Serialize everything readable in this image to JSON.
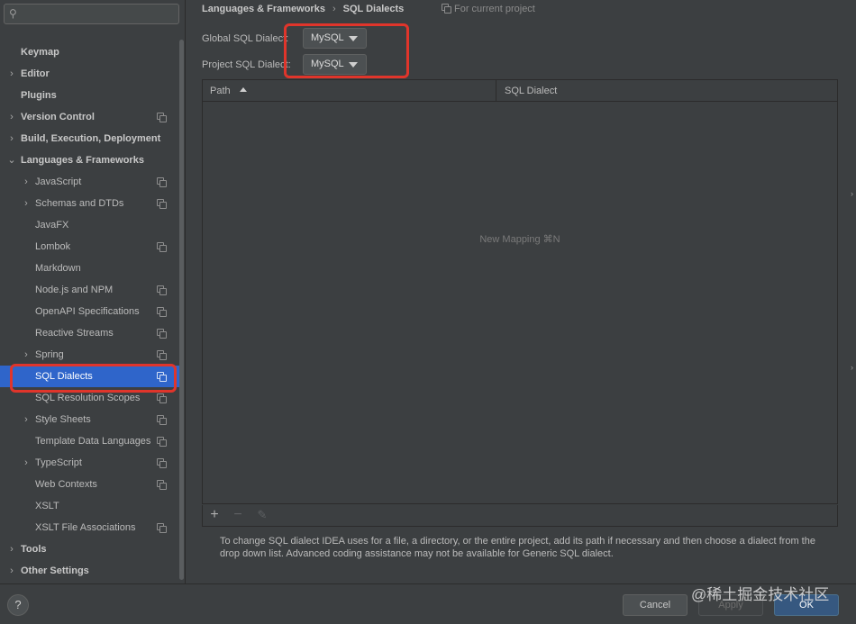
{
  "sidebar": {
    "search_placeholder": "",
    "items": [
      {
        "label": "Keymap",
        "level": 0,
        "bold": true,
        "arrow": "",
        "copy": false
      },
      {
        "label": "Editor",
        "level": 0,
        "bold": true,
        "arrow": "›",
        "copy": false
      },
      {
        "label": "Plugins",
        "level": 0,
        "bold": true,
        "arrow": "",
        "copy": false
      },
      {
        "label": "Version Control",
        "level": 0,
        "bold": true,
        "arrow": "›",
        "copy": true
      },
      {
        "label": "Build, Execution, Deployment",
        "level": 0,
        "bold": true,
        "arrow": "›",
        "copy": false
      },
      {
        "label": "Languages & Frameworks",
        "level": 0,
        "bold": true,
        "arrow": "⌄",
        "copy": false
      },
      {
        "label": "JavaScript",
        "level": 1,
        "bold": false,
        "arrow": "›",
        "copy": true
      },
      {
        "label": "Schemas and DTDs",
        "level": 1,
        "bold": false,
        "arrow": "›",
        "copy": true
      },
      {
        "label": "JavaFX",
        "level": 1,
        "bold": false,
        "arrow": "",
        "copy": false
      },
      {
        "label": "Lombok",
        "level": 1,
        "bold": false,
        "arrow": "",
        "copy": true
      },
      {
        "label": "Markdown",
        "level": 1,
        "bold": false,
        "arrow": "",
        "copy": false
      },
      {
        "label": "Node.js and NPM",
        "level": 1,
        "bold": false,
        "arrow": "",
        "copy": true
      },
      {
        "label": "OpenAPI Specifications",
        "level": 1,
        "bold": false,
        "arrow": "",
        "copy": true
      },
      {
        "label": "Reactive Streams",
        "level": 1,
        "bold": false,
        "arrow": "",
        "copy": true
      },
      {
        "label": "Spring",
        "level": 1,
        "bold": false,
        "arrow": "›",
        "copy": true
      },
      {
        "label": "SQL Dialects",
        "level": 1,
        "bold": false,
        "arrow": "",
        "copy": true,
        "selected": true
      },
      {
        "label": "SQL Resolution Scopes",
        "level": 1,
        "bold": false,
        "arrow": "",
        "copy": true
      },
      {
        "label": "Style Sheets",
        "level": 1,
        "bold": false,
        "arrow": "›",
        "copy": true
      },
      {
        "label": "Template Data Languages",
        "level": 1,
        "bold": false,
        "arrow": "",
        "copy": true
      },
      {
        "label": "TypeScript",
        "level": 1,
        "bold": false,
        "arrow": "›",
        "copy": true
      },
      {
        "label": "Web Contexts",
        "level": 1,
        "bold": false,
        "arrow": "",
        "copy": true
      },
      {
        "label": "XSLT",
        "level": 1,
        "bold": false,
        "arrow": "",
        "copy": false
      },
      {
        "label": "XSLT File Associations",
        "level": 1,
        "bold": false,
        "arrow": "",
        "copy": true
      },
      {
        "label": "Tools",
        "level": 0,
        "bold": true,
        "arrow": "›",
        "copy": false
      },
      {
        "label": "Other Settings",
        "level": 0,
        "bold": true,
        "arrow": "›",
        "copy": false
      }
    ]
  },
  "breadcrumb": {
    "parent": "Languages & Frameworks",
    "separator": "›",
    "current": "SQL Dialects"
  },
  "scope_label": "For current project",
  "fields": {
    "global_label": "Global SQL Dialect:",
    "global_value": "MySQL",
    "project_label": "Project SQL Dialect:",
    "project_value": "MySQL"
  },
  "table": {
    "columns": [
      "Path",
      "SQL Dialect"
    ],
    "empty_text": "New Mapping ⌘N"
  },
  "toolbar": {
    "add": "+",
    "remove": "−",
    "edit": "✎"
  },
  "help_text": "To change SQL dialect IDEA uses for a file, a directory, or the entire project, add its path if necessary and then choose a dialect from the drop down list. Advanced coding assistance may not be available for Generic SQL dialect.",
  "buttons": {
    "help": "?",
    "cancel": "Cancel",
    "apply": "Apply",
    "ok": "OK"
  },
  "watermark": "@稀土掘金技术社区",
  "colors": {
    "selection": "#2f65ca",
    "highlight": "#e0352b",
    "primary": "#365880",
    "background": "#3c3f41"
  }
}
